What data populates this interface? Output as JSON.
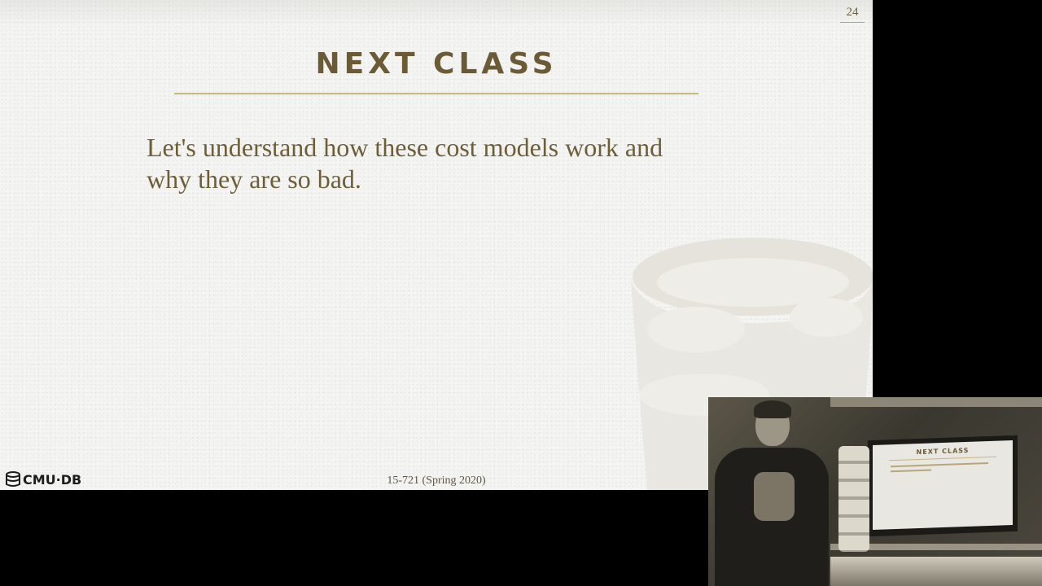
{
  "slide": {
    "number": "24",
    "title": "Next Class",
    "body_lines": [
      "Let's understand how these cost models work and",
      "why they are so bad."
    ],
    "footer_course": "15-721 (Spring 2020)",
    "logo_text": "CMU·DB"
  },
  "webcam": {
    "monitor_title": "NEXT CLASS"
  },
  "colors": {
    "slide_bg": "#f4f4f2",
    "title": "#6a5a36",
    "rule": "#c8b680",
    "body": "#6e5e38"
  }
}
